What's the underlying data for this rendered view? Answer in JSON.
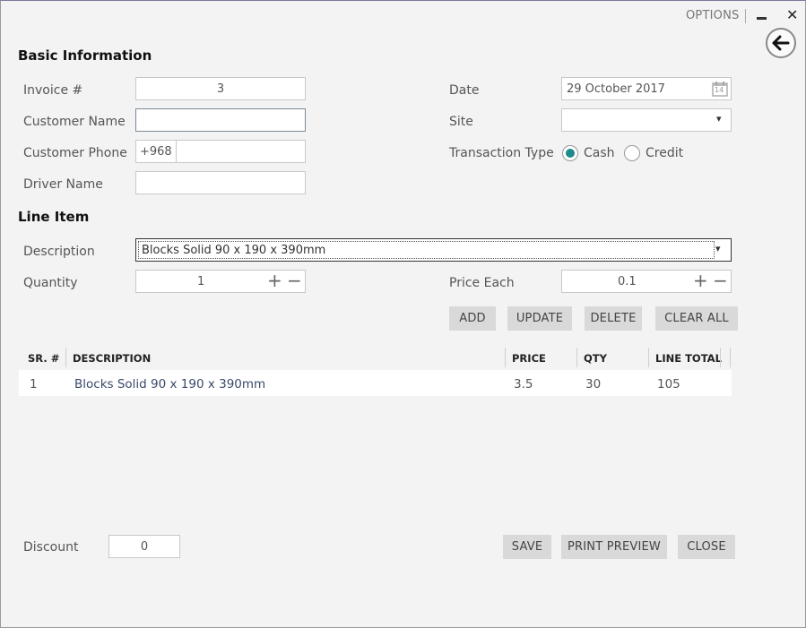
{
  "titlebar": {
    "options_label": "OPTIONS",
    "close_glyph": "✕"
  },
  "basic": {
    "title": "Basic Information",
    "invoice_label": "Invoice #",
    "invoice_value": "3",
    "customer_name_label": "Customer Name",
    "customer_name_value": "",
    "customer_phone_label": "Customer Phone",
    "phone_prefix": "+968",
    "phone_value": "",
    "driver_name_label": "Driver Name",
    "driver_name_value": "",
    "date_label": "Date",
    "date_value": "29 October 2017",
    "calendar_day": "14",
    "site_label": "Site",
    "site_value": "",
    "transaction_type_label": "Transaction Type",
    "cash_label": "Cash",
    "credit_label": "Credit",
    "transaction_selected": "Cash"
  },
  "line_item": {
    "title": "Line Item",
    "description_label": "Description",
    "description_value": "Blocks Solid 90 x 190 x 390mm",
    "quantity_label": "Quantity",
    "quantity_value": "1",
    "price_each_label": "Price Each",
    "price_each_value": "0.1",
    "plus_glyph": "+",
    "minus_glyph": "−",
    "dropdown_glyph": "▾"
  },
  "actions": {
    "add": "ADD",
    "update": "UPDATE",
    "delete": "DELETE",
    "clear_all": "CLEAR ALL"
  },
  "table": {
    "headers": [
      "SR. #",
      "DESCRIPTION",
      "PRICE",
      "QTY",
      "LINE TOTAL"
    ],
    "rows": [
      {
        "sr": "1",
        "description": "Blocks Solid 90 x 190 x 390mm",
        "price": "3.5",
        "qty": "30",
        "line_total": "105"
      }
    ]
  },
  "footer": {
    "discount_label": "Discount",
    "discount_value": "0",
    "save": "SAVE",
    "print_preview": "PRINT PREVIEW",
    "close": "CLOSE"
  },
  "colors": {
    "radio_selected": "#1f8a8a",
    "button_bg": "#d9d9d9",
    "background": "#f3f3f3"
  },
  "icons": [
    "minimize-icon",
    "close-icon",
    "back-arrow-icon",
    "calendar-icon",
    "chevron-down-icon",
    "plus-icon",
    "minus-icon"
  ]
}
